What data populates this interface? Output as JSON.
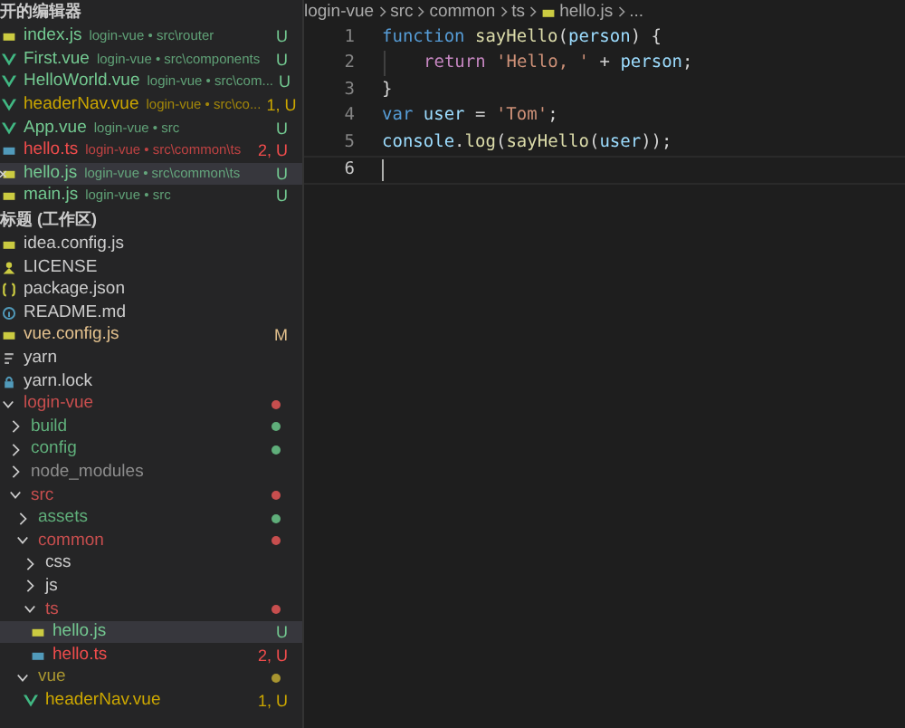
{
  "open_editors": {
    "title": "开的编辑器",
    "items": [
      {
        "kind": "js",
        "name": "index.js",
        "path": "login-vue • src\\router",
        "color": "#73c991",
        "badge": "U",
        "selected": false
      },
      {
        "kind": "vue",
        "name": "First.vue",
        "path": "login-vue • src\\components",
        "color": "#73c991",
        "badge": "U",
        "selected": false
      },
      {
        "kind": "vue",
        "name": "HelloWorld.vue",
        "path": "login-vue • src\\com...",
        "color": "#73c991",
        "badge": "U",
        "selected": false
      },
      {
        "kind": "vue",
        "name": "headerNav.vue",
        "path": "login-vue • src\\co...",
        "color": "#cca700",
        "badge": "1, U",
        "selected": false
      },
      {
        "kind": "vue",
        "name": "App.vue",
        "path": "login-vue • src",
        "color": "#73c991",
        "badge": "U",
        "selected": false
      },
      {
        "kind": "ts",
        "name": "hello.ts",
        "path": "login-vue • src\\common\\ts",
        "color": "#f14c4c",
        "badge": "2, U",
        "selected": false
      },
      {
        "kind": "js",
        "name": "hello.js",
        "path": "login-vue • src\\common\\ts",
        "color": "#73c991",
        "badge": "U",
        "selected": true
      },
      {
        "kind": "js",
        "name": "main.js",
        "path": "login-vue • src",
        "color": "#73c991",
        "badge": "U",
        "selected": false
      }
    ]
  },
  "explorer": {
    "title": "标题 (工作区)",
    "items": [
      {
        "kind": "js",
        "name": "idea.config.js",
        "color": "#cccccc",
        "selected": false
      },
      {
        "kind": "license",
        "name": "LICENSE",
        "color": "#cccccc",
        "selected": false
      },
      {
        "kind": "json",
        "name": "package.json",
        "color": "#cccccc",
        "selected": false
      },
      {
        "kind": "md",
        "name": "README.md",
        "color": "#cccccc",
        "selected": false
      },
      {
        "kind": "js",
        "name": "vue.config.js",
        "color": "#e2c08d",
        "badge": "M",
        "selected": false
      },
      {
        "kind": "yarn",
        "name": "yarn",
        "color": "#cccccc",
        "selected": false
      },
      {
        "kind": "lock",
        "name": "yarn.lock",
        "color": "#cccccc",
        "selected": false
      },
      {
        "kind": "folder",
        "name": "login-vue",
        "color": "#c74e4e",
        "expanded": true,
        "selected": false,
        "children": [
          {
            "kind": "folder",
            "name": "build",
            "color": "#5fae7a",
            "expanded": false,
            "selected": false
          },
          {
            "kind": "folder",
            "name": "config",
            "color": "#5fae7a",
            "expanded": false,
            "selected": false
          },
          {
            "kind": "folder",
            "name": "node_modules",
            "color": "#8c8c8c",
            "expanded": false,
            "selected": false
          },
          {
            "kind": "folder",
            "name": "src",
            "color": "#c74e4e",
            "expanded": true,
            "selected": false,
            "children": [
              {
                "kind": "folder",
                "name": "assets",
                "color": "#5fae7a",
                "expanded": false,
                "selected": false
              },
              {
                "kind": "folder",
                "name": "common",
                "color": "#c74e4e",
                "expanded": true,
                "selected": false,
                "children": [
                  {
                    "kind": "folder",
                    "name": "css",
                    "color": "#cccccc",
                    "expanded": false,
                    "selected": false
                  },
                  {
                    "kind": "folder",
                    "name": "js",
                    "color": "#cccccc",
                    "expanded": false,
                    "selected": false
                  },
                  {
                    "kind": "folder",
                    "name": "ts",
                    "color": "#c74e4e",
                    "expanded": true,
                    "selected": false,
                    "children": [
                      {
                        "kind": "js",
                        "name": "hello.js",
                        "color": "#73c991",
                        "badge": "U",
                        "selected": true
                      },
                      {
                        "kind": "ts",
                        "name": "hello.ts",
                        "color": "#f14c4c",
                        "badge": "2, U",
                        "selected": false
                      }
                    ]
                  }
                ]
              },
              {
                "kind": "folder",
                "name": "vue",
                "color": "#a89530",
                "expanded": true,
                "selected": false,
                "children": [
                  {
                    "kind": "vue",
                    "name": "headerNav.vue",
                    "color": "#cca700",
                    "badge": "1, U",
                    "selected": false
                  }
                ]
              }
            ]
          }
        ]
      }
    ]
  },
  "breadcrumb": [
    {
      "label": "login-vue"
    },
    {
      "label": "src"
    },
    {
      "label": "common"
    },
    {
      "label": "ts"
    },
    {
      "label": "hello.js",
      "kind": "js"
    },
    {
      "label": "..."
    }
  ],
  "editor": {
    "lines": [
      {
        "number": "1",
        "current": false,
        "indented": false,
        "tokens": [
          {
            "kind": "keyword",
            "text": "function "
          },
          {
            "kind": "function",
            "text": "sayHello"
          },
          {
            "kind": "plain",
            "text": "("
          },
          {
            "kind": "variable",
            "text": "person"
          },
          {
            "kind": "plain",
            "text": ") {"
          }
        ]
      },
      {
        "number": "2",
        "current": false,
        "indented": true,
        "tokens": [
          {
            "kind": "control",
            "text": "return "
          },
          {
            "kind": "string",
            "text": "'Hello, '"
          },
          {
            "kind": "plain",
            "text": " + "
          },
          {
            "kind": "variable",
            "text": "person"
          },
          {
            "kind": "plain",
            "text": ";"
          }
        ]
      },
      {
        "number": "3",
        "current": false,
        "indented": false,
        "tokens": [
          {
            "kind": "plain",
            "text": "}"
          }
        ]
      },
      {
        "number": "4",
        "current": false,
        "indented": false,
        "tokens": [
          {
            "kind": "keyword",
            "text": "var "
          },
          {
            "kind": "variable",
            "text": "user"
          },
          {
            "kind": "plain",
            "text": " = "
          },
          {
            "kind": "string",
            "text": "'Tom'"
          },
          {
            "kind": "plain",
            "text": ";"
          }
        ]
      },
      {
        "number": "5",
        "current": false,
        "indented": false,
        "tokens": [
          {
            "kind": "variable",
            "text": "console"
          },
          {
            "kind": "plain",
            "text": "."
          },
          {
            "kind": "function",
            "text": "log"
          },
          {
            "kind": "plain",
            "text": "("
          },
          {
            "kind": "function",
            "text": "sayHello"
          },
          {
            "kind": "plain",
            "text": "("
          },
          {
            "kind": "variable",
            "text": "user"
          },
          {
            "kind": "plain",
            "text": "));"
          }
        ]
      },
      {
        "number": "6",
        "current": true,
        "indented": false
      }
    ]
  }
}
